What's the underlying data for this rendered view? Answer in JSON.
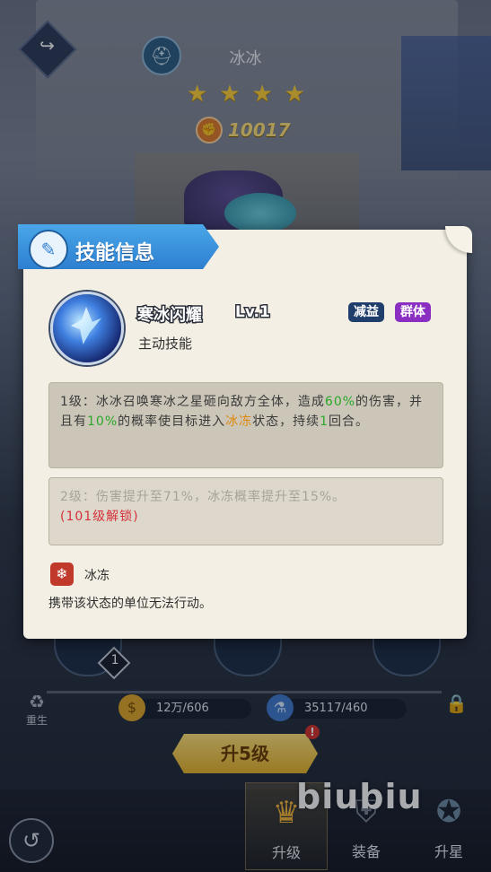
{
  "hero": {
    "name": "冰冰",
    "stars": 4,
    "power": "10017"
  },
  "panel": {
    "title": "技能信息",
    "skill": {
      "name": "寒冰闪耀",
      "level": "Lv.1",
      "type": "主动技能",
      "tags": [
        "减益",
        "群体"
      ]
    },
    "levels": [
      {
        "prefix": "1级：",
        "segments": [
          {
            "text": "冰冰召唤寒冰之星砸向敌方全体，造成",
            "style": "normal"
          },
          {
            "text": "60%",
            "style": "green"
          },
          {
            "text": "的伤害，并且有",
            "style": "normal"
          },
          {
            "text": "10%",
            "style": "green"
          },
          {
            "text": "的概率使目标进入",
            "style": "normal"
          },
          {
            "text": "冰冻",
            "style": "orange"
          },
          {
            "text": "状态，持续",
            "style": "normal"
          },
          {
            "text": "1",
            "style": "green"
          },
          {
            "text": "回合。",
            "style": "normal"
          }
        ]
      },
      {
        "prefix": "2级：",
        "text": "伤害提升至71%，冰冻概率提升至15%。",
        "unlock": "(101级解锁)"
      }
    ],
    "status": {
      "name": "冰冻",
      "description": "携带该状态的单位无法行动。"
    }
  },
  "bottom": {
    "rebirth_label": "重生",
    "gold": "12万/606",
    "exp": "35117/460",
    "orb_badge": "1",
    "upgrade_button": "升5级",
    "alert": "!",
    "tabs": [
      "升级",
      "装备",
      "升星"
    ],
    "watermark": "biubiu"
  },
  "colors": {
    "accent_blue": "#2d7fd0",
    "tag_debuff": "#1f3e6c",
    "tag_group": "#8a2fc2",
    "highlight_green": "#2aa82a",
    "highlight_orange": "#e08a10",
    "highlight_red": "#d6303a",
    "button_gold": "#e8b42a"
  },
  "icons": {
    "back": "back-arrow-icon",
    "helmet": "helmet-icon",
    "star": "star-icon",
    "power": "fist-icon",
    "skill_info": "scroll-icon",
    "status": "snowflake-icon",
    "gold": "coin-icon",
    "exp": "potion-icon",
    "lock": "lock-icon",
    "upgrade_tab": "flame-icon",
    "equip_tab": "armor-icon",
    "starup_tab": "star-shield-icon"
  }
}
